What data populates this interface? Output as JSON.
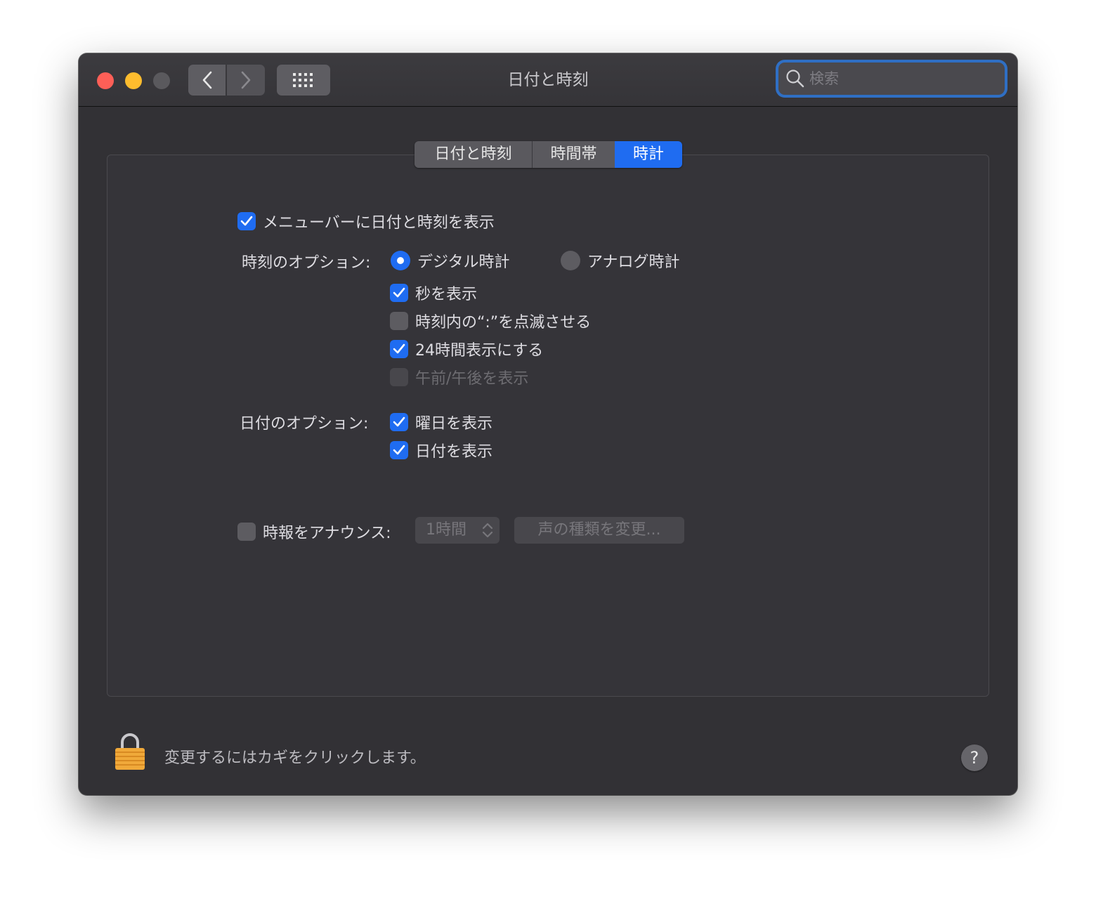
{
  "window": {
    "title": "日付と時刻"
  },
  "search": {
    "placeholder": "検索"
  },
  "tabs": [
    {
      "label": "日付と時刻",
      "selected": false
    },
    {
      "label": "時間帯",
      "selected": false
    },
    {
      "label": "時計",
      "selected": true
    }
  ],
  "clock": {
    "show_in_menubar": {
      "label": "メニューバーに日付と時刻を表示",
      "checked": true
    },
    "time_options_label": "時刻のオプション:",
    "digital": {
      "label": "デジタル時計",
      "selected": true
    },
    "analog": {
      "label": "アナログ時計",
      "selected": false
    },
    "show_seconds": {
      "label": "秒を表示",
      "checked": true
    },
    "flash_separators": {
      "label": "時刻内の“:”を点滅させる",
      "checked": false
    },
    "use_24h": {
      "label": "24時間表示にする",
      "checked": true
    },
    "show_ampm": {
      "label": "午前/午後を表示",
      "checked": false,
      "disabled": true
    },
    "date_options_label": "日付のオプション:",
    "show_weekday": {
      "label": "曜日を表示",
      "checked": true
    },
    "show_date": {
      "label": "日付を表示",
      "checked": true
    },
    "announce": {
      "label": "時報をアナウンス:",
      "checked": false
    },
    "interval": {
      "value": "1時間",
      "disabled": true
    },
    "voice_button": {
      "label": "声の種類を変更...",
      "disabled": true
    }
  },
  "footer": {
    "lock_text": "変更するにはカギをクリックします。",
    "help_label": "?"
  },
  "colors": {
    "accent": "#1f6cf1",
    "window_bg": "#323135",
    "close": "#fe5f57",
    "minimize": "#febc2e"
  },
  "icons": [
    "back-chevron-icon",
    "forward-chevron-icon",
    "grid-icon",
    "search-icon",
    "lock-icon",
    "checkmark-icon"
  ]
}
